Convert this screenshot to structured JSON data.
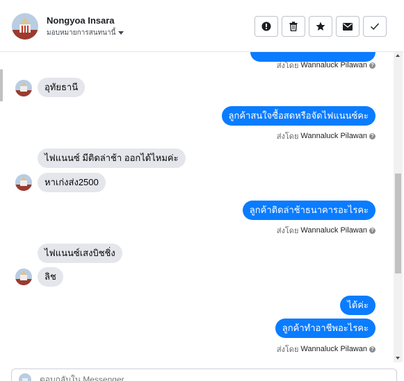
{
  "header": {
    "contact_name": "Nongyoa Insara",
    "assign_label": "มอบหมายการสนทนานี้",
    "actions": [
      {
        "icon": "alert-icon"
      },
      {
        "icon": "trash-icon"
      },
      {
        "icon": "star-icon"
      },
      {
        "icon": "mail-icon"
      },
      {
        "icon": "check-icon"
      }
    ]
  },
  "thread": {
    "sent_by_prefix": "ส่งโดย",
    "sent_by_name": "Wannaluck Pilawan",
    "messages": [
      {
        "dir": "in",
        "text": "อุทัยธานี"
      },
      {
        "dir": "out",
        "text": "ลูกค้าสนใจซื้อสดหรือจัดไฟแนนซ์คะ"
      },
      {
        "dir": "in",
        "text": "ไฟแนนซ์ มีติดล่าช้า ออกได้ไหมค่ะ"
      },
      {
        "dir": "in",
        "text": "หาเก่งส่ง2500"
      },
      {
        "dir": "out",
        "text": "ลูกค้าติดล่าช้าธนาคารอะไรคะ"
      },
      {
        "dir": "in",
        "text": "ไฟแนนซ์เสงบิชชิ่ง"
      },
      {
        "dir": "in",
        "text": "ลิช"
      },
      {
        "dir": "out",
        "text": "ได้ค่ะ"
      },
      {
        "dir": "out",
        "text": "ลูกค้าทำอาชีพอะไรคะ"
      }
    ]
  },
  "composer": {
    "placeholder": "ตอบกลับใน Messenger"
  },
  "colors": {
    "outgoing_bubble": "#0a7cff",
    "incoming_bubble": "#e4e6eb"
  }
}
